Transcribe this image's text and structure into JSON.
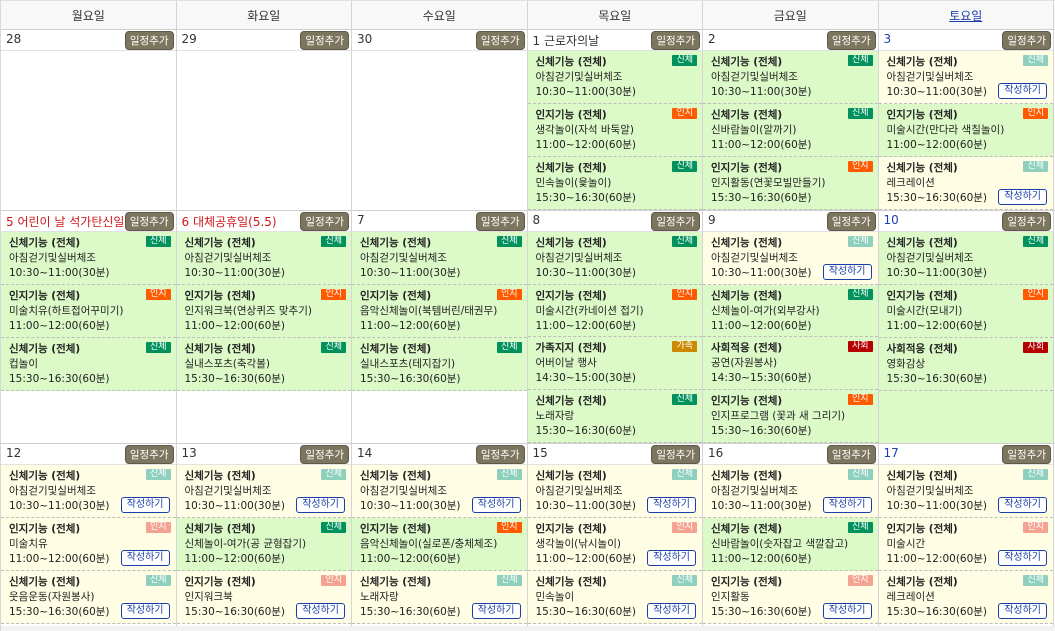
{
  "headers": [
    "월요일",
    "화요일",
    "수요일",
    "목요일",
    "금요일",
    "토요일"
  ],
  "add_label": "일정추가",
  "write_label": "작성하기",
  "weeks": [
    {
      "days": [
        {
          "label": "28",
          "events": []
        },
        {
          "label": "29",
          "events": []
        },
        {
          "label": "30",
          "events": []
        },
        {
          "label": "1 근로자의날",
          "events": [
            {
              "title": "신체기능 (전체)",
              "desc": "아침걷기및실버체조",
              "time": "10:30~11:00(30분)",
              "badge": "신체",
              "type": "phy"
            },
            {
              "title": "인지기능 (전체)",
              "desc": "생각놀이(자석 바둑알)",
              "time": "11:00~12:00(60분)",
              "badge": "인지",
              "type": "cog"
            },
            {
              "title": "신체기능 (전체)",
              "desc": "민속놀이(윷놀이)",
              "time": "15:30~16:30(60분)",
              "badge": "신체",
              "type": "phy"
            }
          ]
        },
        {
          "label": "2",
          "events": [
            {
              "title": "신체기능 (전체)",
              "desc": "아침걷기및실버체조",
              "time": "10:30~11:00(30분)",
              "badge": "신체",
              "type": "phy"
            },
            {
              "title": "신체기능 (전체)",
              "desc": "신바람놀이(알까기)",
              "time": "11:00~12:00(60분)",
              "badge": "신체",
              "type": "phy"
            },
            {
              "title": "인지기능 (전체)",
              "desc": "인지활동(연꽃모빌만들기)",
              "time": "15:30~16:30(60분)",
              "badge": "인지",
              "type": "cog"
            }
          ]
        },
        {
          "label": "3",
          "events": [
            {
              "title": "신체기능 (전체)",
              "desc": "아침걷기및실버체조",
              "time": "10:30~11:00(30분)",
              "badge": "신체",
              "type": "phy",
              "pending": true
            },
            {
              "title": "인지기능 (전체)",
              "desc": "미술시간(만다라 색칠놀이)",
              "time": "11:00~12:00(60분)",
              "badge": "인지",
              "type": "cog"
            },
            {
              "title": "신체기능 (전체)",
              "desc": "레크레이션",
              "time": "15:30~16:30(60분)",
              "badge": "신체",
              "type": "phy",
              "pending": true
            }
          ]
        }
      ]
    },
    {
      "days": [
        {
          "label": "5 어린이 날 석가탄신일",
          "events": [
            {
              "title": "신체기능 (전체)",
              "desc": "아침걷기및실버체조",
              "time": "10:30~11:00(30분)",
              "badge": "신체",
              "type": "phy"
            },
            {
              "title": "인지기능 (전체)",
              "desc": "미술치유(하트접어꾸미기)",
              "time": "11:00~12:00(60분)",
              "badge": "인지",
              "type": "cog"
            },
            {
              "title": "신체기능 (전체)",
              "desc": "컵놀이",
              "time": "15:30~16:30(60분)",
              "badge": "신체",
              "type": "phy"
            }
          ]
        },
        {
          "label": "6 대체공휴일(5.5)",
          "events": [
            {
              "title": "신체기능 (전체)",
              "desc": "아침걷기및실버체조",
              "time": "10:30~11:00(30분)",
              "badge": "신체",
              "type": "phy"
            },
            {
              "title": "인지기능 (전체)",
              "desc": "인지워크북(연상퀴즈 맞추기)",
              "time": "11:00~12:00(60분)",
              "badge": "인지",
              "type": "cog"
            },
            {
              "title": "신체기능 (전체)",
              "desc": "실내스포츠(축각볼)",
              "time": "15:30~16:30(60분)",
              "badge": "신체",
              "type": "phy"
            }
          ]
        },
        {
          "label": "7",
          "events": [
            {
              "title": "신체기능 (전체)",
              "desc": "아침걷기및실버체조",
              "time": "10:30~11:00(30분)",
              "badge": "신체",
              "type": "phy"
            },
            {
              "title": "인지기능 (전체)",
              "desc": "음악신체놀이(북템버린/태권무)",
              "time": "11:00~12:00(60분)",
              "badge": "인지",
              "type": "cog"
            },
            {
              "title": "신체기능 (전체)",
              "desc": "실내스포츠(테지잡기)",
              "time": "15:30~16:30(60분)",
              "badge": "신체",
              "type": "phy"
            }
          ]
        },
        {
          "label": "8",
          "events": [
            {
              "title": "신체기능 (전체)",
              "desc": "아침걷기및실버체조",
              "time": "10:30~11:00(30분)",
              "badge": "신체",
              "type": "phy"
            },
            {
              "title": "인지기능 (전체)",
              "desc": "미술시간(카네이션 접기)",
              "time": "11:00~12:00(60분)",
              "badge": "인지",
              "type": "cog"
            },
            {
              "title": "가족지지 (전체)",
              "desc": "어버이날 행사",
              "time": "14:30~15:00(30분)",
              "badge": "가족",
              "type": "fam"
            },
            {
              "title": "신체기능 (전체)",
              "desc": "노래자랑",
              "time": "15:30~16:30(60분)",
              "badge": "신체",
              "type": "phy"
            }
          ]
        },
        {
          "label": "9",
          "events": [
            {
              "title": "신체기능 (전체)",
              "desc": "아침걷기및실버체조",
              "time": "10:30~11:00(30분)",
              "badge": "신체",
              "type": "phy",
              "pending": true
            },
            {
              "title": "신체기능 (전체)",
              "desc": "신체놀이-여가(외부강사)",
              "time": "11:00~12:00(60분)",
              "badge": "신체",
              "type": "phy"
            },
            {
              "title": "사회적응 (전체)",
              "desc": "공연(자원봉사)",
              "time": "14:30~15:30(60분)",
              "badge": "사회",
              "type": "soc"
            },
            {
              "title": "인지기능 (전체)",
              "desc": "인지프로그램 (꽃과 새 그리기)",
              "time": "15:30~16:30(60분)",
              "badge": "인지",
              "type": "cog"
            }
          ]
        },
        {
          "label": "10",
          "events": [
            {
              "title": "신체기능 (전체)",
              "desc": "아침걷기및실버체조",
              "time": "10:30~11:00(30분)",
              "badge": "신체",
              "type": "phy"
            },
            {
              "title": "인지기능 (전체)",
              "desc": "미술시간(모내기)",
              "time": "11:00~12:00(60분)",
              "badge": "인지",
              "type": "cog"
            },
            {
              "title": "사회적응 (전체)",
              "desc": "영화감상",
              "time": "15:30~16:30(60분)",
              "badge": "사회",
              "type": "soc"
            }
          ]
        }
      ]
    },
    {
      "days": [
        {
          "label": "12",
          "events": [
            {
              "title": "신체기능 (전체)",
              "desc": "아침걷기및실버체조",
              "time": "10:30~11:00(30분)",
              "badge": "신체",
              "type": "phy",
              "pending": true
            },
            {
              "title": "인지기능 (전체)",
              "desc": "미술치유",
              "time": "11:00~12:00(60분)",
              "badge": "인지",
              "type": "cog",
              "pending": true
            },
            {
              "title": "신체기능 (전체)",
              "desc": "웃음운동(자원봉사)",
              "time": "15:30~16:30(60분)",
              "badge": "신체",
              "type": "phy",
              "pending": true
            }
          ]
        },
        {
          "label": "13",
          "events": [
            {
              "title": "신체기능 (전체)",
              "desc": "아침걷기및실버체조",
              "time": "10:30~11:00(30분)",
              "badge": "신체",
              "type": "phy",
              "pending": true
            },
            {
              "title": "신체기능 (전체)",
              "desc": "신체놀이-여가(공 균형잡기)",
              "time": "11:00~12:00(60분)",
              "badge": "신체",
              "type": "phy"
            },
            {
              "title": "인지기능 (전체)",
              "desc": "인지워크북",
              "time": "15:30~16:30(60분)",
              "badge": "인지",
              "type": "cog",
              "pending": true
            }
          ]
        },
        {
          "label": "14",
          "events": [
            {
              "title": "신체기능 (전체)",
              "desc": "아침걷기및실버체조",
              "time": "10:30~11:00(30분)",
              "badge": "신체",
              "type": "phy",
              "pending": true
            },
            {
              "title": "인지기능 (전체)",
              "desc": "음악신체놀이(실로폰/충체체조)",
              "time": "11:00~12:00(60분)",
              "badge": "인지",
              "type": "cog"
            },
            {
              "title": "신체기능 (전체)",
              "desc": "노래자랑",
              "time": "15:30~16:30(60분)",
              "badge": "신체",
              "type": "phy",
              "pending": true
            }
          ]
        },
        {
          "label": "15",
          "events": [
            {
              "title": "신체기능 (전체)",
              "desc": "아침걷기및실버체조",
              "time": "10:30~11:00(30분)",
              "badge": "신체",
              "type": "phy",
              "pending": true
            },
            {
              "title": "인지기능 (전체)",
              "desc": "생각놀이(낚시놀이)",
              "time": "11:00~12:00(60분)",
              "badge": "인지",
              "type": "cog",
              "pending": true
            },
            {
              "title": "신체기능 (전체)",
              "desc": "민속놀이",
              "time": "15:30~16:30(60분)",
              "badge": "신체",
              "type": "phy",
              "pending": true
            }
          ]
        },
        {
          "label": "16",
          "events": [
            {
              "title": "신체기능 (전체)",
              "desc": "아침걷기및실버체조",
              "time": "10:30~11:00(30분)",
              "badge": "신체",
              "type": "phy",
              "pending": true
            },
            {
              "title": "신체기능 (전체)",
              "desc": "신바람놀이(숫자잡고 색깔잡고)",
              "time": "11:00~12:00(60분)",
              "badge": "신체",
              "type": "phy"
            },
            {
              "title": "인지기능 (전체)",
              "desc": "인지활동",
              "time": "15:30~16:30(60분)",
              "badge": "인지",
              "type": "cog",
              "pending": true
            }
          ]
        },
        {
          "label": "17",
          "events": [
            {
              "title": "신체기능 (전체)",
              "desc": "아침걷기및실버체조",
              "time": "10:30~11:00(30분)",
              "badge": "신체",
              "type": "phy",
              "pending": true
            },
            {
              "title": "인지기능 (전체)",
              "desc": "미술시간",
              "time": "11:00~12:00(60분)",
              "badge": "인지",
              "type": "cog",
              "pending": true
            },
            {
              "title": "신체기능 (전체)",
              "desc": "레크레이션",
              "time": "15:30~16:30(60분)",
              "badge": "신체",
              "type": "phy",
              "pending": true
            }
          ]
        }
      ]
    }
  ]
}
